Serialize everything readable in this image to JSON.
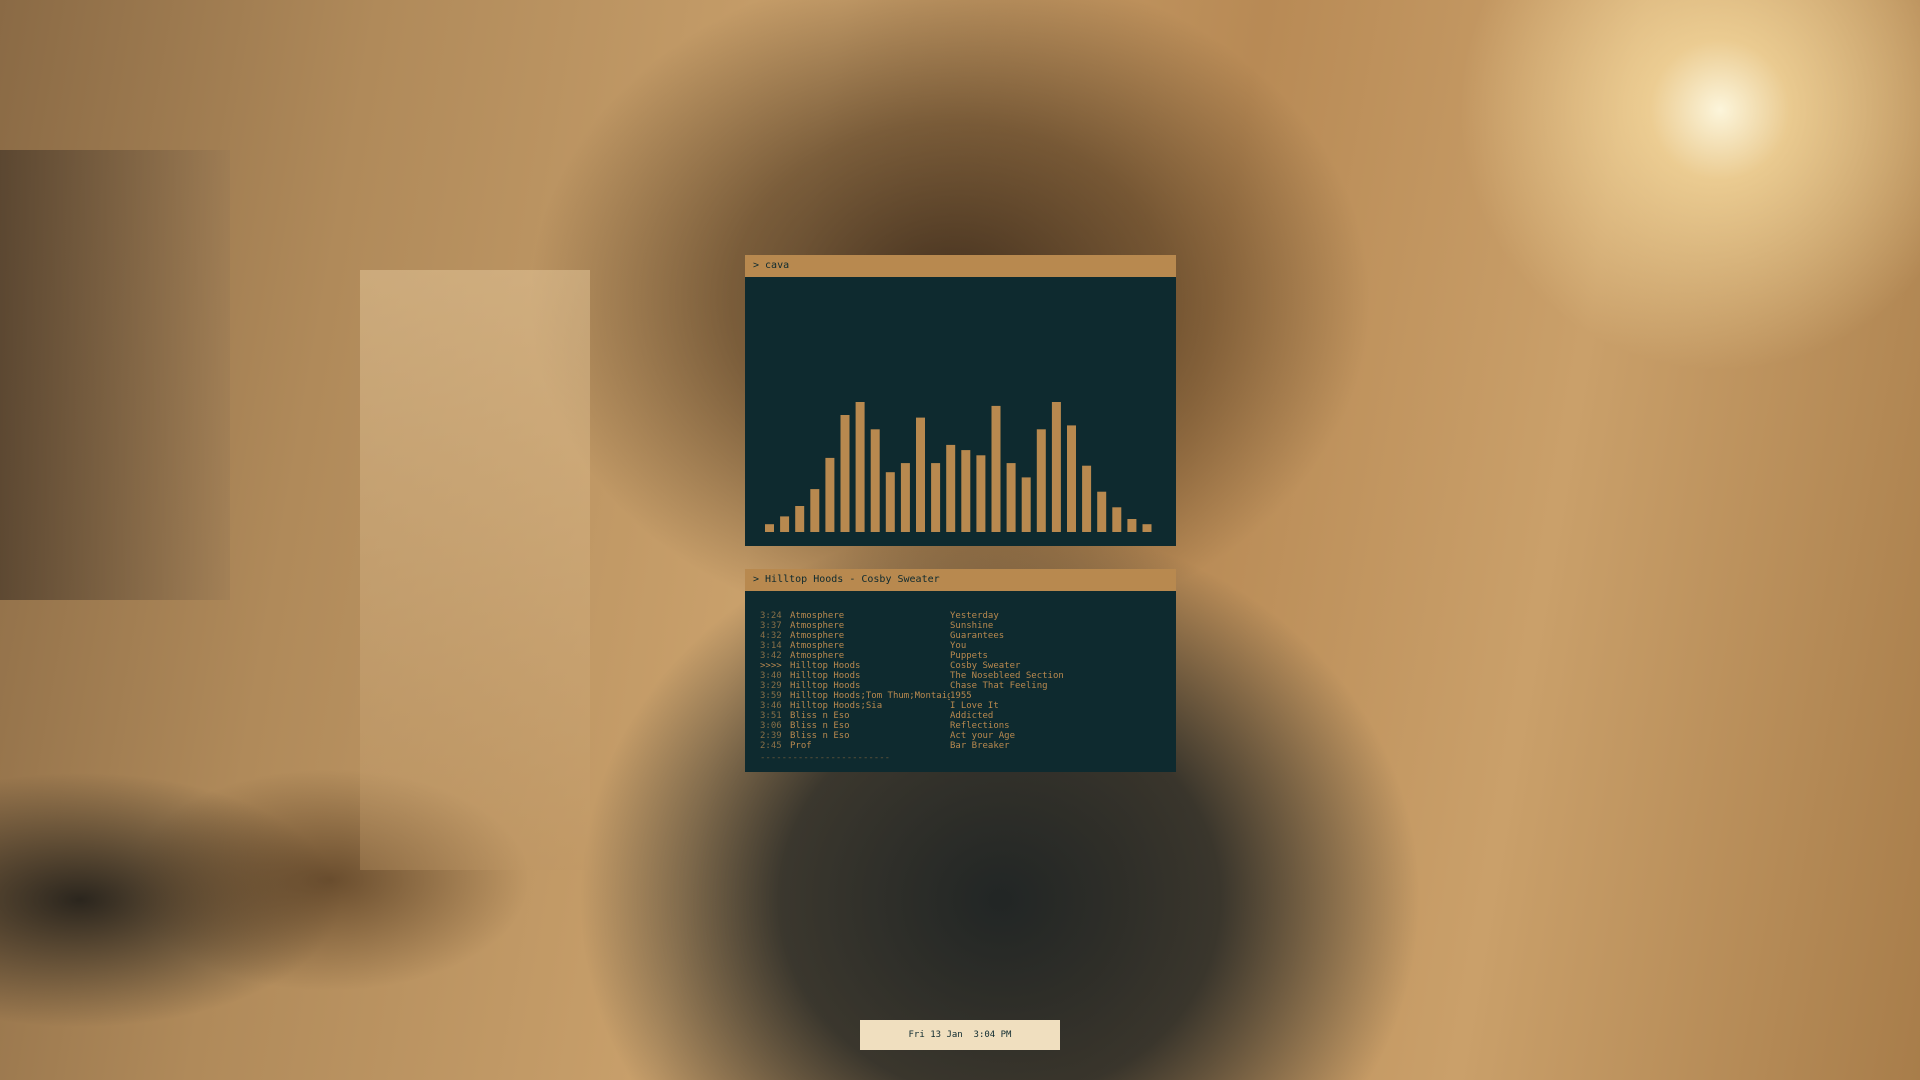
{
  "cava_window": {
    "title": "> cava",
    "bar_color": "#b8894f",
    "levels": [
      6,
      12,
      20,
      33,
      57,
      90,
      100,
      79,
      46,
      53,
      88,
      53,
      67,
      63,
      59,
      97,
      53,
      42,
      79,
      100,
      82,
      51,
      31,
      19,
      10,
      6
    ]
  },
  "ncmpcpp_window": {
    "title": "> Hilltop Hoods - Cosby Sweater",
    "playlist": [
      {
        "time": "3:24",
        "artist": "Atmosphere",
        "title": "Yesterday"
      },
      {
        "time": "3:37",
        "artist": "Atmosphere",
        "title": "Sunshine"
      },
      {
        "time": "4:32",
        "artist": "Atmosphere",
        "title": "Guarantees"
      },
      {
        "time": "3:14",
        "artist": "Atmosphere",
        "title": "You"
      },
      {
        "time": "3:42",
        "artist": "Atmosphere",
        "title": "Puppets"
      },
      {
        "time": ">>>>",
        "artist": "Hilltop Hoods",
        "title": "Cosby Sweater"
      },
      {
        "time": "3:40",
        "artist": "Hilltop Hoods",
        "title": "The Nosebleed Section"
      },
      {
        "time": "3:29",
        "artist": "Hilltop Hoods",
        "title": "Chase That Feeling"
      },
      {
        "time": "3:59",
        "artist": "Hilltop Hoods;Tom Thum;Montaigne",
        "title": "1955"
      },
      {
        "time": "3:46",
        "artist": "Hilltop Hoods;Sia",
        "title": "I Love It"
      },
      {
        "time": "3:51",
        "artist": "Bliss n Eso",
        "title": "Addicted"
      },
      {
        "time": "3:06",
        "artist": "Bliss n Eso",
        "title": "Reflections"
      },
      {
        "time": "2:39",
        "artist": "Bliss n Eso",
        "title": "Act your Age"
      },
      {
        "time": "2:45",
        "artist": "Prof",
        "title": "Bar Breaker"
      }
    ],
    "divider": "------------------------------"
  },
  "clock": {
    "text": "Fri 13 Jan  3:04 PM"
  }
}
